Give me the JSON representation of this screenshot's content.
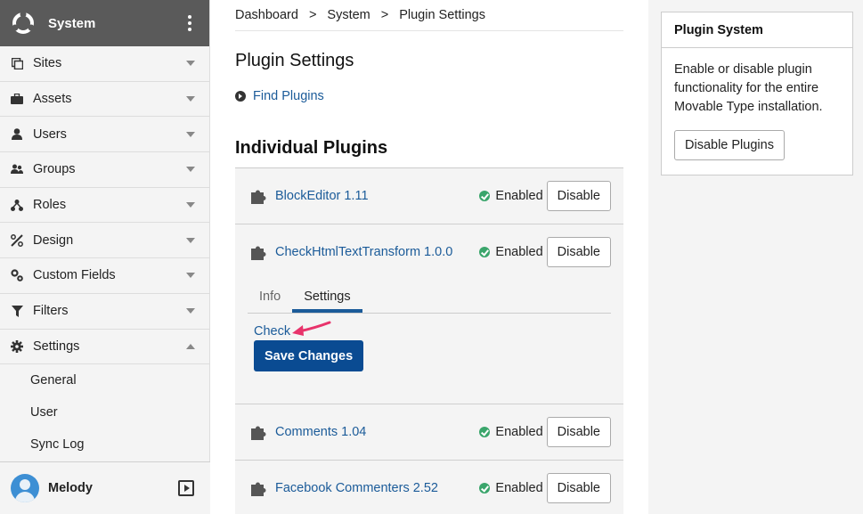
{
  "sidebar": {
    "title": "System",
    "items": [
      {
        "label": "Sites",
        "icon": "sites-icon"
      },
      {
        "label": "Assets",
        "icon": "briefcase-icon"
      },
      {
        "label": "Users",
        "icon": "user-icon"
      },
      {
        "label": "Groups",
        "icon": "groups-icon"
      },
      {
        "label": "Roles",
        "icon": "roles-icon"
      },
      {
        "label": "Design",
        "icon": "design-icon"
      },
      {
        "label": "Custom Fields",
        "icon": "gears-icon"
      },
      {
        "label": "Filters",
        "icon": "filter-icon"
      },
      {
        "label": "Settings",
        "icon": "gear-icon"
      }
    ],
    "sub_items": [
      {
        "label": "General"
      },
      {
        "label": "User"
      },
      {
        "label": "Sync Log"
      }
    ],
    "user_name": "Melody"
  },
  "breadcrumb": {
    "items": [
      "Dashboard",
      "System",
      "Plugin Settings"
    ],
    "separator": ">"
  },
  "main": {
    "page_title": "Plugin Settings",
    "find_plugins": "Find Plugins",
    "section_title": "Individual Plugins",
    "plugins": [
      {
        "name": "BlockEditor 1.11",
        "status": "Enabled",
        "button": "Disable"
      },
      {
        "name": "CheckHtmlTextTransform 1.0.0",
        "status": "Enabled",
        "button": "Disable"
      },
      {
        "name": "Comments 1.04",
        "status": "Enabled",
        "button": "Disable"
      },
      {
        "name": "Facebook Commenters 2.52",
        "status": "Enabled",
        "button": "Disable"
      }
    ],
    "tabs": [
      {
        "label": "Info",
        "active": false
      },
      {
        "label": "Settings",
        "active": true
      }
    ],
    "check_link": "Check",
    "save_button": "Save Changes"
  },
  "panel": {
    "title": "Plugin System",
    "description": "Enable or disable plugin functionality for the entire Movable Type installation.",
    "button": "Disable Plugins"
  },
  "colors": {
    "link": "#1b5b99",
    "primary_button": "#0a4b92",
    "enabled": "#3aa56b",
    "annotation_arrow": "#e8336b"
  }
}
